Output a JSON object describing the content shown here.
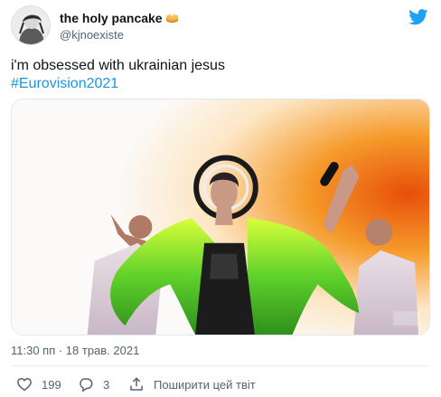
{
  "author": {
    "display_name": "the holy pancake",
    "handle": "@kjnoexiste",
    "name_emoji_icon": "pancake-emoji-icon"
  },
  "tweet": {
    "text": "i'm obsessed with ukrainian jesus",
    "hashtag": "#Eurovision2021",
    "timestamp": "11:30 пп · 18 трав. 2021"
  },
  "actions": {
    "like_count": "199",
    "reply_count": "3",
    "share_label": "Поширити цей твіт"
  },
  "colors": {
    "brand_blue": "#1da1f2",
    "hashtag_blue": "#1b95e0",
    "muted_text": "#536471"
  }
}
